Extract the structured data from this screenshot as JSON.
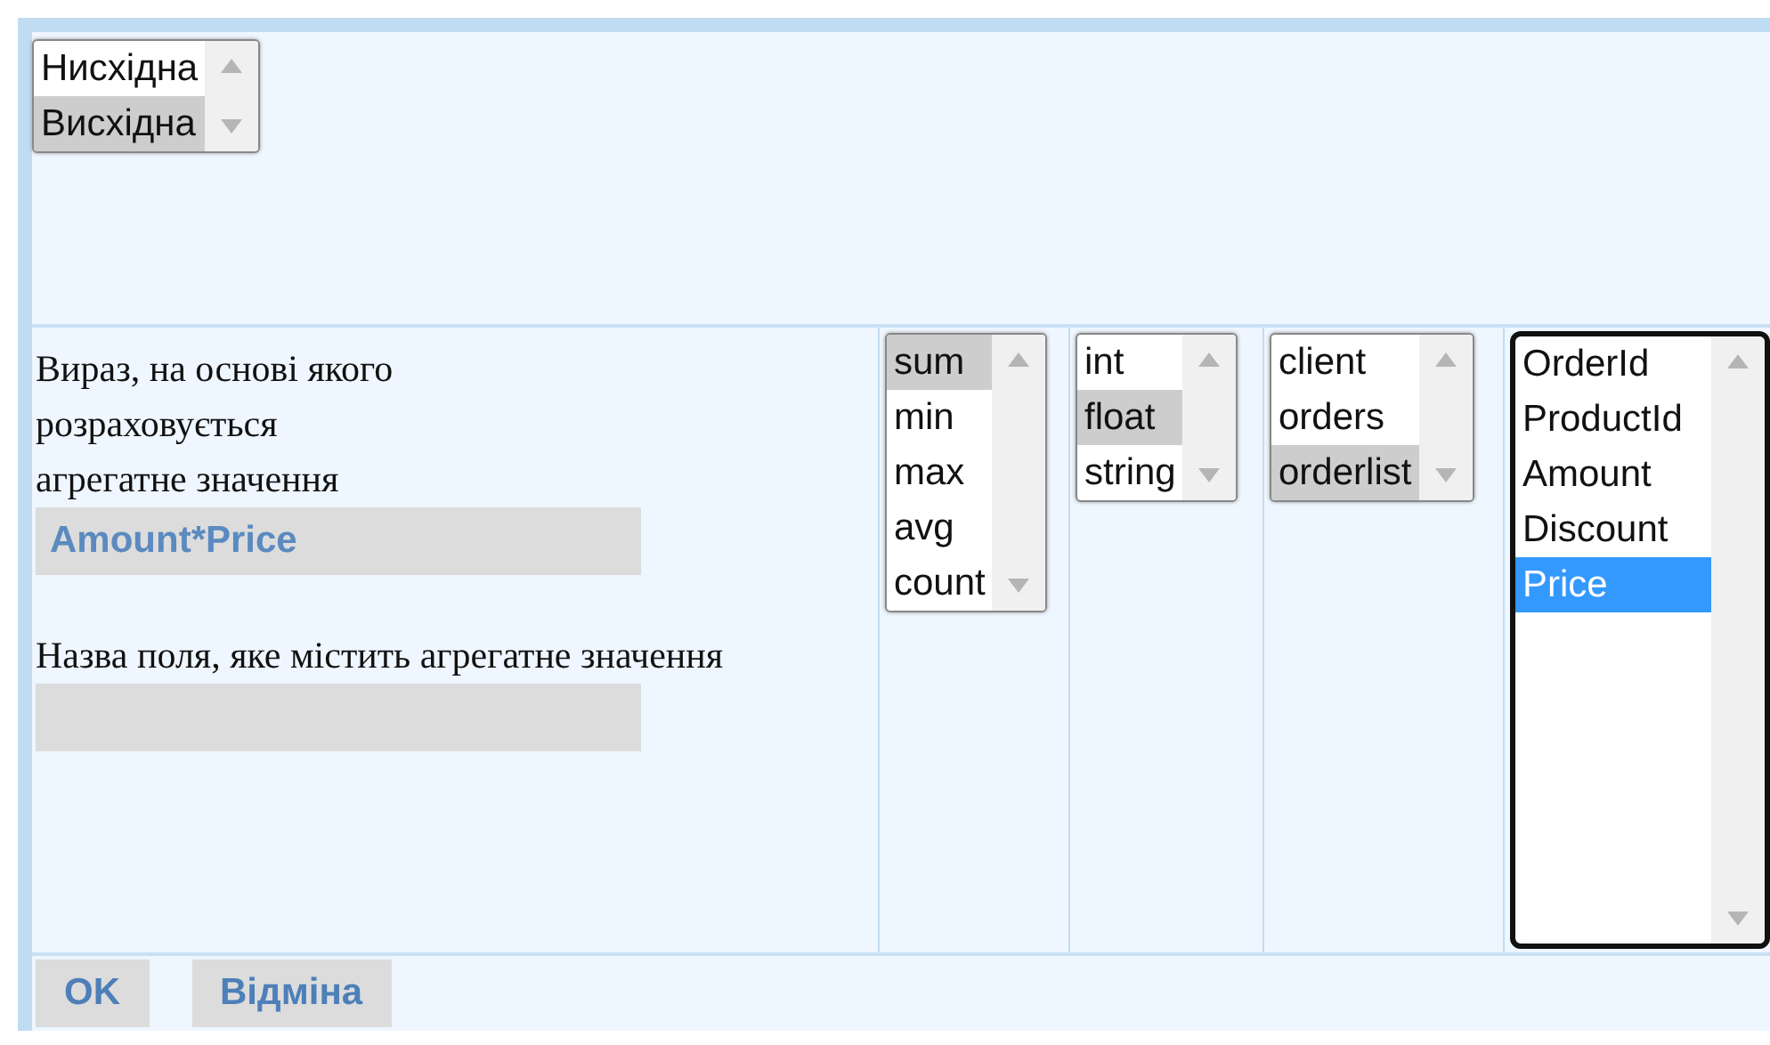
{
  "sort_order": {
    "focused": false,
    "items": [
      {
        "label": "Нисхідна",
        "selected": false
      },
      {
        "label": "Висхідна",
        "selected": true
      }
    ]
  },
  "expression": {
    "label": "Вираз, на основі якого\nрозраховується\nагрегатне значення",
    "value": "Amount*Price"
  },
  "field_name": {
    "label": "Назва поля, яке містить агрегатне значення"
  },
  "lists": [
    {
      "focused": false,
      "items": [
        {
          "label": "sum",
          "selected": true
        },
        {
          "label": "min",
          "selected": false
        },
        {
          "label": "max",
          "selected": false
        },
        {
          "label": "avg",
          "selected": false
        },
        {
          "label": "count",
          "selected": false
        }
      ]
    },
    {
      "focused": false,
      "items": [
        {
          "label": "int",
          "selected": false
        },
        {
          "label": "float",
          "selected": true
        },
        {
          "label": "string",
          "selected": false
        }
      ]
    },
    {
      "focused": false,
      "items": [
        {
          "label": "client",
          "selected": false
        },
        {
          "label": "orders",
          "selected": false
        },
        {
          "label": "orderlist",
          "selected": true
        }
      ]
    },
    {
      "focused": true,
      "items": [
        {
          "label": "OrderId",
          "selected": false
        },
        {
          "label": "ProductId",
          "selected": false
        },
        {
          "label": "Amount",
          "selected": false
        },
        {
          "label": "Discount",
          "selected": false
        },
        {
          "label": "Price",
          "selected": true
        }
      ]
    }
  ],
  "buttons": [
    "OK",
    "Відміна"
  ]
}
